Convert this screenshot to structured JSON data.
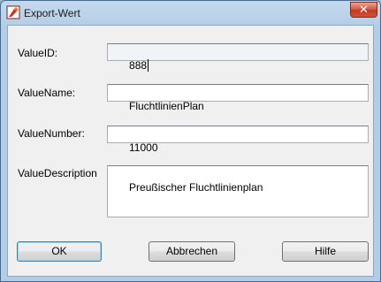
{
  "window": {
    "title": "Export-Wert",
    "close_symbol": "✕"
  },
  "form": {
    "value_id": {
      "label": "ValueID:",
      "value": "888"
    },
    "value_name": {
      "label": "ValueName:",
      "value": "FluchtlinienPlan"
    },
    "value_number": {
      "label": "ValueNumber:",
      "value": "11000"
    },
    "value_description": {
      "label": "ValueDescription",
      "value": "Preußischer Fluchtlinienplan"
    }
  },
  "buttons": {
    "ok": "OK",
    "cancel": "Abbrechen",
    "help": "Hilfe"
  },
  "icons": {
    "app": "app-icon",
    "close": "close-icon"
  }
}
